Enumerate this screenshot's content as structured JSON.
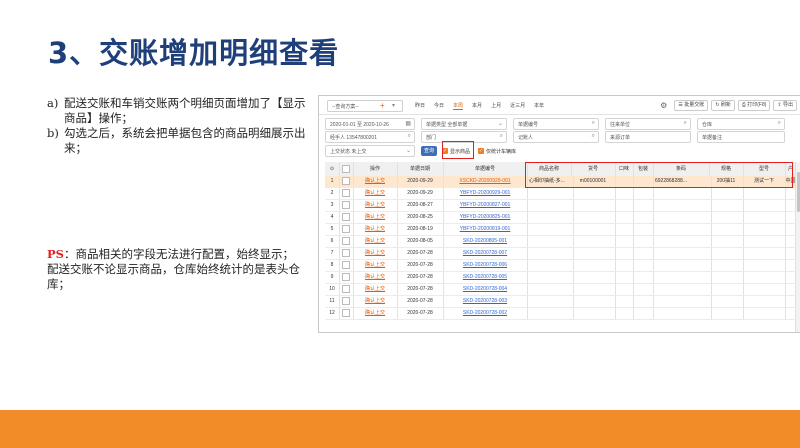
{
  "slide": {
    "title": "3、交账增加明细查看",
    "notes": [
      {
        "marker": "a)",
        "text": "配送交账和车销交账两个明细页面增加了【显示商品】操作；"
      },
      {
        "marker": "b)",
        "text": "勾选之后，系统会把单据包含的商品明细展示出来；"
      }
    ],
    "ps_label": "PS",
    "ps_text": "：商品相关的字段无法进行配置，始终显示；",
    "ps_text2": "配送交账不论显示商品，仓库始终统计的是表头仓库；"
  },
  "toolbar": {
    "scheme_placeholder": "--查询方案--",
    "plus": "+",
    "date_tabs": [
      "昨日",
      "今日",
      "本周",
      "本月",
      "上月",
      "近三月",
      "本年"
    ],
    "active_tab_index": 2,
    "batch_export": "批量交账",
    "refresh": "刷新",
    "print": "打印(F8)",
    "export": "导出"
  },
  "filters": {
    "row1": [
      {
        "text": "2020-01-01 至 2020-10-26",
        "icon": "calendar-icon"
      },
      {
        "text": "单据类型  全部单据",
        "icon": "chevron-down-icon"
      },
      {
        "text": "单据编号",
        "icon": "search-icon"
      },
      {
        "text": "往来单位",
        "icon": "search-icon"
      },
      {
        "text": "仓库",
        "icon": "search-icon"
      }
    ],
    "row2": [
      {
        "text": "经手人  13547800201",
        "icon": "search-icon"
      },
      {
        "text": "部门",
        "icon": "search-icon"
      },
      {
        "text": "记账人",
        "icon": "search-icon"
      },
      {
        "text": "来源订单",
        "icon": ""
      },
      {
        "text": "单据备注",
        "icon": ""
      }
    ],
    "status": {
      "text": "上交状态  未上交",
      "icon": "chevron-down-icon"
    },
    "query_button": "查询",
    "show_goods": "显示商品",
    "only_stat": "仅统计车辆库"
  },
  "grid": {
    "columns": [
      "",
      "",
      "操作",
      "单据日期",
      "单据编号",
      "商品名称",
      "货号",
      "口味",
      "包装",
      "条码",
      "规格",
      "型号",
      "户"
    ],
    "action_text": "确认上交",
    "rows": [
      {
        "no": "1",
        "date": "2020-09-29",
        "code": "XSCKD-20200929-001",
        "goods": "心相印抽纸-多...",
        "sku": "m00100001",
        "barcode": "6922868288...",
        "spec": "200抽11",
        "model": "测试一下",
        "house": "中国"
      },
      {
        "no": "2",
        "date": "2020-09-29",
        "code": "YBFYD-20200929-001"
      },
      {
        "no": "3",
        "date": "2020-08-27",
        "code": "YBFYD-20200827-001"
      },
      {
        "no": "4",
        "date": "2020-08-25",
        "code": "YBFYD-20200825-001"
      },
      {
        "no": "5",
        "date": "2020-08-19",
        "code": "YBFYD-20200819-001"
      },
      {
        "no": "6",
        "date": "2020-08-05",
        "code": "SKD-20200805-001"
      },
      {
        "no": "7",
        "date": "2020-07-28",
        "code": "SKD-20200728-007"
      },
      {
        "no": "8",
        "date": "2020-07-28",
        "code": "SKD-20200728-006"
      },
      {
        "no": "9",
        "date": "2020-07-28",
        "code": "SKD-20200728-005"
      },
      {
        "no": "10",
        "date": "2020-07-28",
        "code": "SKD-20200728-004"
      },
      {
        "no": "11",
        "date": "2020-07-28",
        "code": "SKD-20200728-003"
      },
      {
        "no": "12",
        "date": "2020-07-28",
        "code": "SKD-20200728-002"
      }
    ]
  }
}
